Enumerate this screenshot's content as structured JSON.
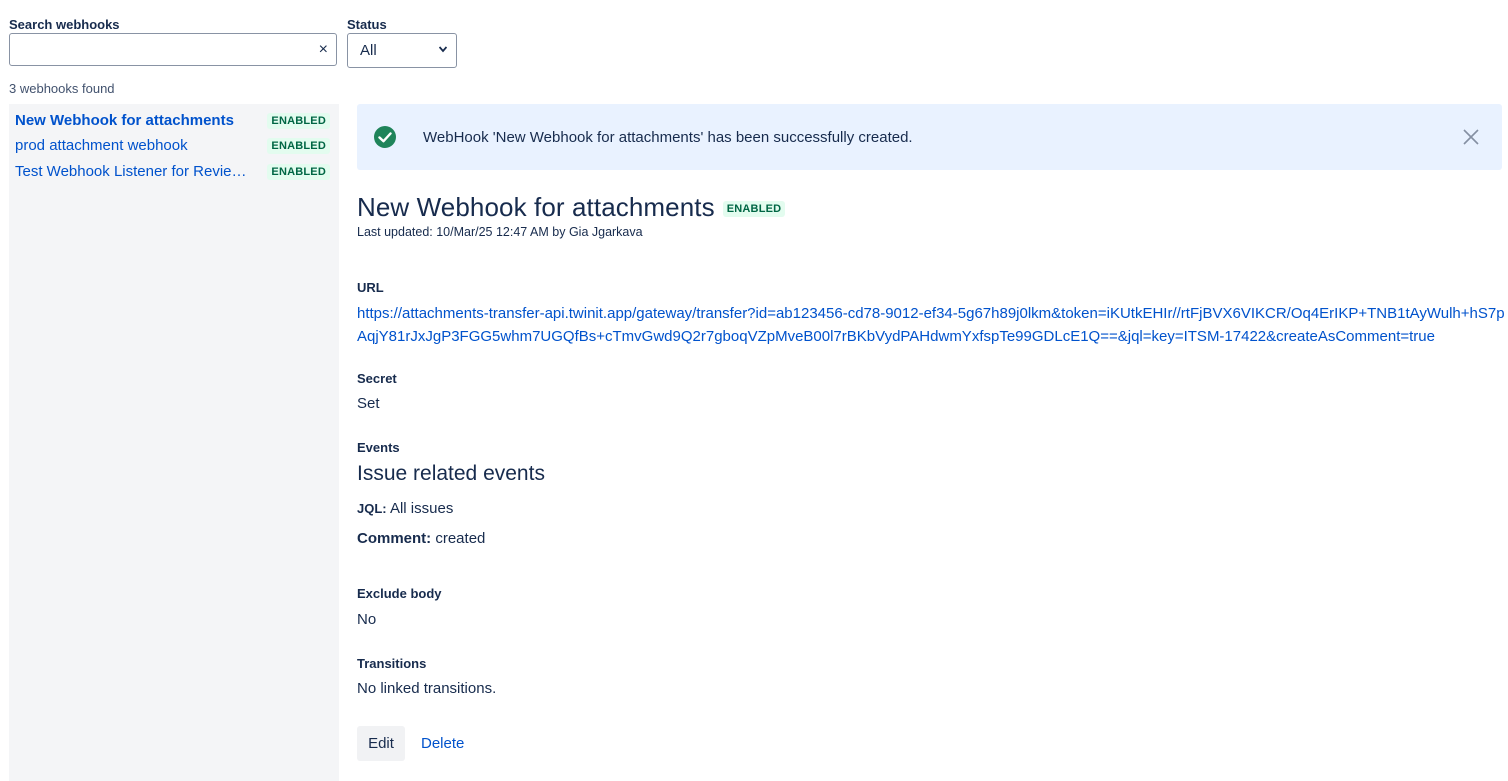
{
  "filters": {
    "search_label": "Search webhooks",
    "search_value": "",
    "search_clear_glyph": "×",
    "status_label": "Status",
    "status_selected": "All"
  },
  "results_count": "3 webhooks found",
  "sidebar": {
    "items": [
      {
        "name": "New Webhook for attachments",
        "status": "ENABLED",
        "active": true
      },
      {
        "name": "prod attachment webhook",
        "status": "ENABLED",
        "active": false
      },
      {
        "name": "Test Webhook Listener for Review Process",
        "status": "ENABLED",
        "active": false
      }
    ]
  },
  "flag": {
    "message": "WebHook 'New Webhook for attachments' has been successfully created.",
    "icon": "check-circle-icon",
    "color": "#1f845a"
  },
  "detail": {
    "title": "New Webhook for attachments",
    "status": "ENABLED",
    "last_updated": "Last updated: 10/Mar/25 12:47 AM by Gia Jgarkava",
    "url_label": "URL",
    "url": "https://attachments-transfer-api.twinit.app/gateway/transfer?id=ab123456-cd78-9012-ef34-5g67h89j0lkm&token=iKUtkEHIr//rtFjBVX6VIKCR/Oq4ErIKP+TNB1tAyWulh+hS7pAqjY81rJxJgP3FGG5whm7UGQfBs+cTmvGwd9Q2r7gboqVZpMveB00l7rBKbVydPAHdwmYxfspTe99GDLcE1Q==&jql=key=ITSM-17422&createAsComment=true",
    "secret_label": "Secret",
    "secret_value": "Set",
    "events_label": "Events",
    "events_heading": "Issue related events",
    "jql_key": "JQL:",
    "jql_value": "All issues",
    "comment_key": "Comment:",
    "comment_value": "created",
    "exclude_label": "Exclude body",
    "exclude_value": "No",
    "transitions_label": "Transitions",
    "transitions_value": "No linked transitions.",
    "edit_label": "Edit",
    "delete_label": "Delete"
  },
  "colors": {
    "link": "#0052cc",
    "badge_bg": "#e3fcef",
    "badge_text": "#006644",
    "flag_bg": "#e9f2ff",
    "sidebar_bg": "#f4f5f7"
  }
}
